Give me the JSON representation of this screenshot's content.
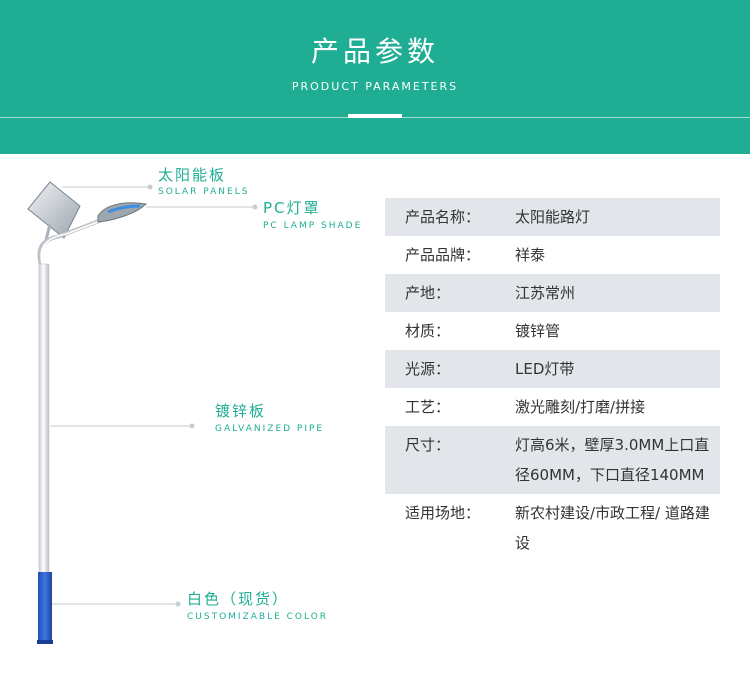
{
  "header": {
    "title": "产品参数",
    "subtitle": "PRODUCT PARAMETERS"
  },
  "colors": {
    "accent": "#1fae93",
    "row_shade": "#e2e5e9",
    "text": "#333333",
    "pole_base": "#2d5fc8"
  },
  "callouts": {
    "solar": {
      "title": "太阳能板",
      "sub": "SOLAR PANELS"
    },
    "shade": {
      "title": "PC灯罩",
      "sub": "PC LAMP SHADE"
    },
    "pipe": {
      "title": "镀锌板",
      "sub": "GALVANIZED PIPE"
    },
    "color": {
      "title": "白色（现货）",
      "sub": "CUSTOMIZABLE COLOR"
    }
  },
  "params": [
    {
      "key": "产品名称：",
      "value": "太阳能路灯"
    },
    {
      "key": "产品品牌：",
      "value": "祥泰"
    },
    {
      "key": "产地：",
      "value": "江苏常州"
    },
    {
      "key": "材质：",
      "value": "镀锌管"
    },
    {
      "key": "光源：",
      "value": "LED灯带"
    },
    {
      "key": "工艺：",
      "value": "激光雕刻/打磨/拼接"
    },
    {
      "key": "尺寸：",
      "value": "灯高6米，壁厚3.0MM上口直径60MM，下口直径140MM"
    },
    {
      "key": "适用场地：",
      "value": "新农村建设/市政工程/ 道路建设"
    }
  ]
}
